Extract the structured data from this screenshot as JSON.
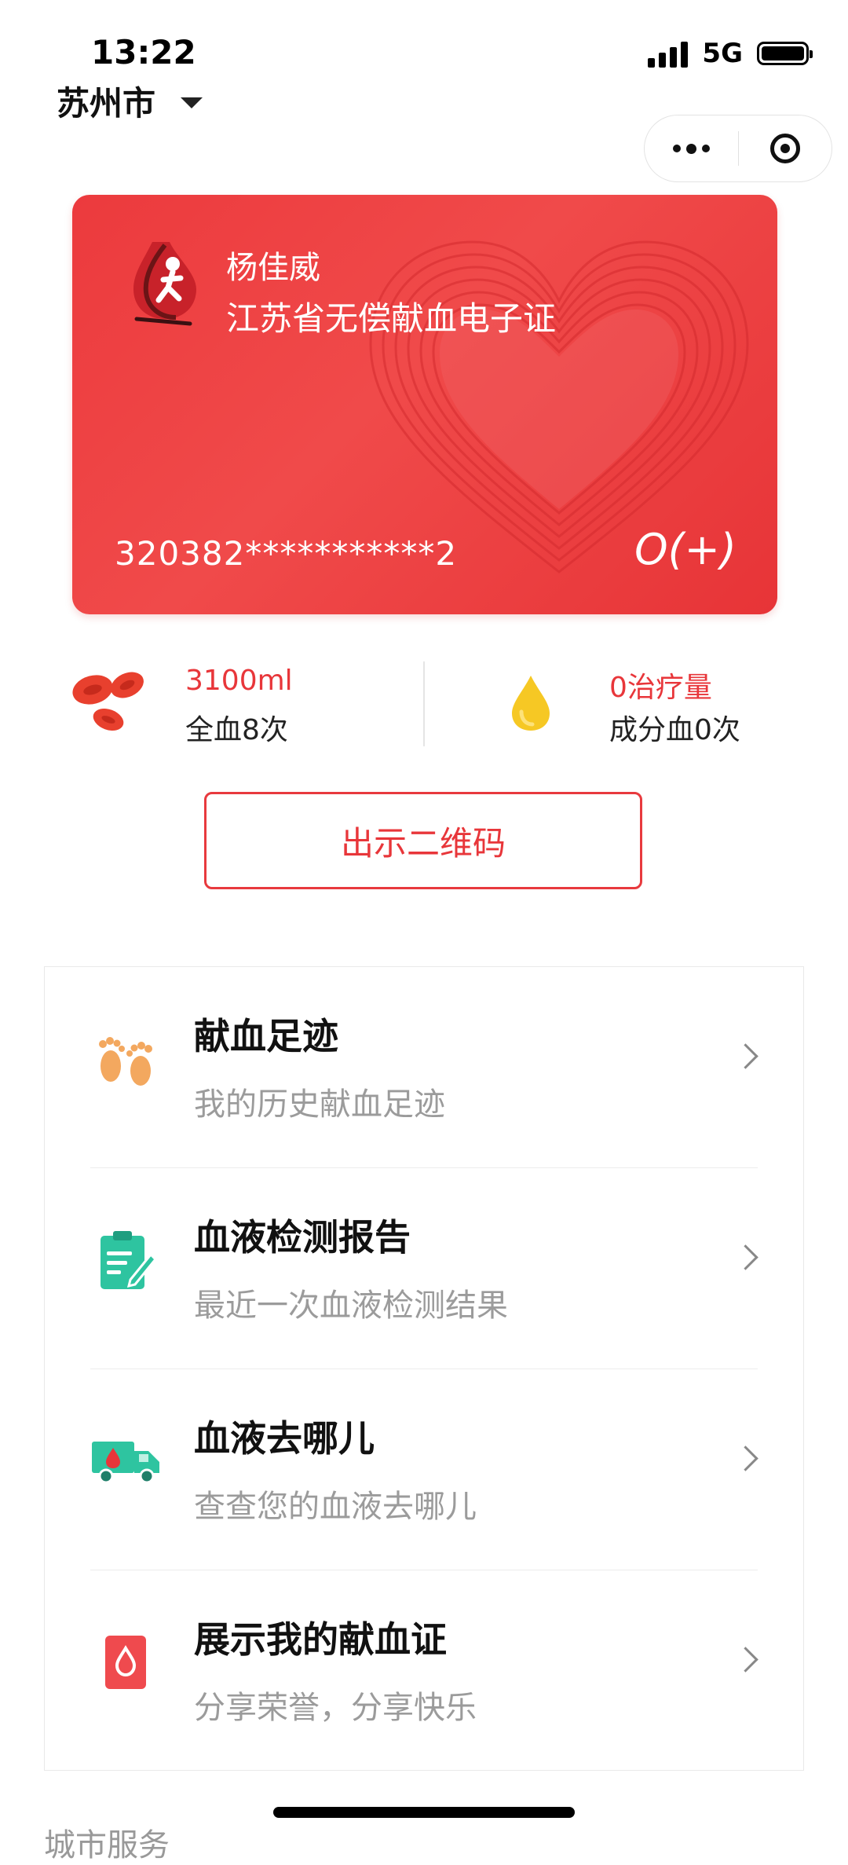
{
  "status_bar": {
    "time": "13:22",
    "network": "5G"
  },
  "header": {
    "city": "苏州市"
  },
  "card": {
    "name": "杨佳威",
    "title": "江苏省无偿献血电子证",
    "id_masked": "320382***********2",
    "blood_type": "O(+)"
  },
  "stats": {
    "whole_blood": {
      "amount": "3100ml",
      "count": "全血8次"
    },
    "components": {
      "amount": "0治疗量",
      "count": "成分血0次"
    }
  },
  "qr_button": {
    "label": "出示二维码"
  },
  "menu": {
    "items": [
      {
        "title": "献血足迹",
        "subtitle": "我的历史献血足迹",
        "icon": "footprints-icon"
      },
      {
        "title": "血液检测报告",
        "subtitle": "最近一次血液检测结果",
        "icon": "clipboard-report-icon"
      },
      {
        "title": "血液去哪儿",
        "subtitle": "查查您的血液去哪儿",
        "icon": "delivery-truck-icon"
      },
      {
        "title": "展示我的献血证",
        "subtitle": "分享荣誉，分享快乐",
        "icon": "blood-card-icon"
      }
    ]
  },
  "next_section": {
    "label": "城市服务"
  },
  "colors": {
    "accent": "#e8363a",
    "card": "#ee4043",
    "green": "#2ec4a0",
    "orange": "#f3a85f"
  }
}
